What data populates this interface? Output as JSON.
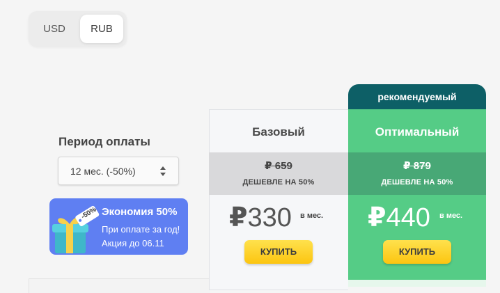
{
  "currency": {
    "options": [
      "USD",
      "RUB"
    ],
    "selected": "RUB"
  },
  "period": {
    "label": "Период оплаты",
    "selected_value": "12 мес. (-50%)"
  },
  "promo": {
    "badge": "-50%",
    "title": "Экономия 50%",
    "line1": "При оплате за год!",
    "line2": "Акция до 06.11"
  },
  "plans": [
    {
      "name": "Базовый",
      "old_price": "₽ 659",
      "discount_note": "ДЕШЕВЛЕ НА 50%",
      "currency_symbol": "₽",
      "price": "330",
      "period": "в мес.",
      "buy_label": "КУПИТЬ"
    },
    {
      "name": "Оптимальный",
      "badge": "рекомендуемый",
      "old_price": "₽ 879",
      "discount_note": "ДЕШЕВЛЕ НА 50%",
      "currency_symbol": "₽",
      "price": "440",
      "period": "в мес.",
      "buy_label": "КУПИТЬ"
    }
  ],
  "colors": {
    "background": "#f5f5f5",
    "optimal_green": "#55cc86",
    "recommended_teal": "#0d5f66",
    "promo_blue": "#5f7ff2",
    "buy_yellow": "#fcc510"
  }
}
